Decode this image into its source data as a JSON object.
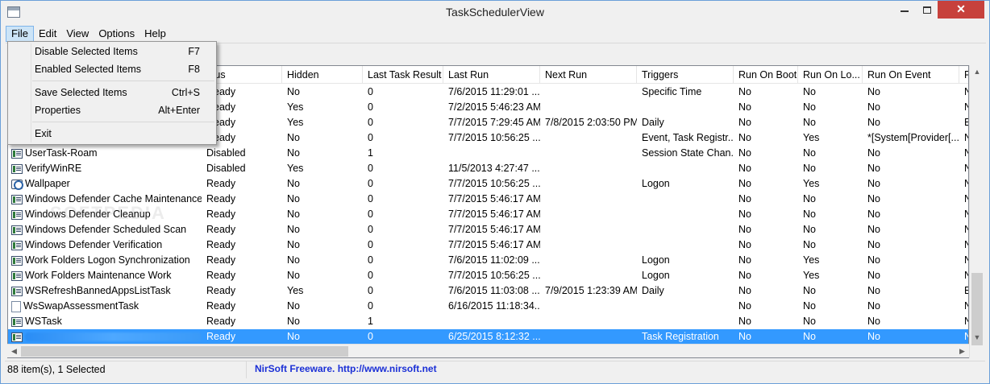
{
  "window": {
    "title": "TaskSchedulerView",
    "close_glyph": "✕"
  },
  "menubar": [
    "File",
    "Edit",
    "View",
    "Options",
    "Help"
  ],
  "file_menu": {
    "items": [
      {
        "label": "Disable Selected Items",
        "shortcut": "F7"
      },
      {
        "label": "Enabled Selected Items",
        "shortcut": "F8"
      },
      {
        "label": "Save Selected Items",
        "shortcut": "Ctrl+S"
      },
      {
        "label": "Properties",
        "shortcut": "Alt+Enter"
      },
      {
        "label": "Exit",
        "shortcut": ""
      }
    ]
  },
  "columns": [
    "",
    "atus",
    "Hidden",
    "Last Task Result",
    "Last Run",
    "Next Run",
    "Triggers",
    "Run On Boot",
    "Run On Lo...",
    "Run On Event",
    "R"
  ],
  "rows": [
    {
      "icon": "task",
      "name": "",
      "status": "Ready",
      "hidden": "No",
      "result": "0",
      "last_run": "7/6/2015 11:29:01 ...",
      "next_run": "",
      "triggers": "Specific Time",
      "boot": "No",
      "logon": "No",
      "event": "No",
      "r": "N"
    },
    {
      "icon": "task",
      "name": "",
      "status": "Ready",
      "hidden": "Yes",
      "result": "0",
      "last_run": "7/2/2015 5:46:23 AM",
      "next_run": "",
      "triggers": "",
      "boot": "No",
      "logon": "No",
      "event": "No",
      "r": "N"
    },
    {
      "icon": "task",
      "name": "",
      "status": "Ready",
      "hidden": "Yes",
      "result": "0",
      "last_run": "7/7/2015 7:29:45 AM",
      "next_run": "7/8/2015 2:03:50 PM",
      "triggers": "Daily",
      "boot": "No",
      "logon": "No",
      "event": "No",
      "r": "E"
    },
    {
      "icon": "task",
      "name": "",
      "status": "Ready",
      "hidden": "No",
      "result": "0",
      "last_run": "7/7/2015 10:56:25 ...",
      "next_run": "",
      "triggers": "Event, Task Registr...",
      "boot": "No",
      "logon": "Yes",
      "event": "*[System[Provider[...",
      "r": "N"
    },
    {
      "icon": "task",
      "name": "UserTask-Roam",
      "status": "Disabled",
      "hidden": "No",
      "result": "1",
      "last_run": "",
      "next_run": "",
      "triggers": "Session State Chan...",
      "boot": "No",
      "logon": "No",
      "event": "No",
      "r": "N"
    },
    {
      "icon": "task",
      "name": "VerifyWinRE",
      "status": "Disabled",
      "hidden": "Yes",
      "result": "0",
      "last_run": "11/5/2013 4:27:47 ...",
      "next_run": "",
      "triggers": "",
      "boot": "No",
      "logon": "No",
      "event": "No",
      "r": "N"
    },
    {
      "icon": "gear",
      "name": "Wallpaper",
      "status": "Ready",
      "hidden": "No",
      "result": "0",
      "last_run": "7/7/2015 10:56:25 ...",
      "next_run": "",
      "triggers": "Logon",
      "boot": "No",
      "logon": "Yes",
      "event": "No",
      "r": "N"
    },
    {
      "icon": "task",
      "name": "Windows Defender Cache Maintenance",
      "status": "Ready",
      "hidden": "No",
      "result": "0",
      "last_run": "7/7/2015 5:46:17 AM",
      "next_run": "",
      "triggers": "",
      "boot": "No",
      "logon": "No",
      "event": "No",
      "r": "N"
    },
    {
      "icon": "task",
      "name": "Windows Defender Cleanup",
      "status": "Ready",
      "hidden": "No",
      "result": "0",
      "last_run": "7/7/2015 5:46:17 AM",
      "next_run": "",
      "triggers": "",
      "boot": "No",
      "logon": "No",
      "event": "No",
      "r": "N"
    },
    {
      "icon": "task",
      "name": "Windows Defender Scheduled Scan",
      "status": "Ready",
      "hidden": "No",
      "result": "0",
      "last_run": "7/7/2015 5:46:17 AM",
      "next_run": "",
      "triggers": "",
      "boot": "No",
      "logon": "No",
      "event": "No",
      "r": "N"
    },
    {
      "icon": "task",
      "name": "Windows Defender Verification",
      "status": "Ready",
      "hidden": "No",
      "result": "0",
      "last_run": "7/7/2015 5:46:17 AM",
      "next_run": "",
      "triggers": "",
      "boot": "No",
      "logon": "No",
      "event": "No",
      "r": "N"
    },
    {
      "icon": "task",
      "name": "Work Folders Logon Synchronization",
      "status": "Ready",
      "hidden": "No",
      "result": "0",
      "last_run": "7/6/2015 11:02:09 ...",
      "next_run": "",
      "triggers": "Logon",
      "boot": "No",
      "logon": "Yes",
      "event": "No",
      "r": "N"
    },
    {
      "icon": "task",
      "name": "Work Folders Maintenance Work",
      "status": "Ready",
      "hidden": "No",
      "result": "0",
      "last_run": "7/7/2015 10:56:25 ...",
      "next_run": "",
      "triggers": "Logon",
      "boot": "No",
      "logon": "Yes",
      "event": "No",
      "r": "N"
    },
    {
      "icon": "task",
      "name": "WSRefreshBannedAppsListTask",
      "status": "Ready",
      "hidden": "Yes",
      "result": "0",
      "last_run": "7/6/2015 11:03:08 ...",
      "next_run": "7/9/2015 1:23:39 AM",
      "triggers": "Daily",
      "boot": "No",
      "logon": "No",
      "event": "No",
      "r": "E"
    },
    {
      "icon": "page",
      "name": "WsSwapAssessmentTask",
      "status": "Ready",
      "hidden": "No",
      "result": "0",
      "last_run": "6/16/2015 11:18:34...",
      "next_run": "",
      "triggers": "",
      "boot": "No",
      "logon": "No",
      "event": "No",
      "r": "N"
    },
    {
      "icon": "task",
      "name": "WSTask",
      "status": "Ready",
      "hidden": "No",
      "result": "1",
      "last_run": "",
      "next_run": "",
      "triggers": "",
      "boot": "No",
      "logon": "No",
      "event": "No",
      "r": "N"
    },
    {
      "icon": "task",
      "name": "",
      "status": "Ready",
      "hidden": "No",
      "result": "0",
      "last_run": "6/25/2015 8:12:32 ...",
      "next_run": "",
      "triggers": "Task Registration",
      "boot": "No",
      "logon": "No",
      "event": "No",
      "r": "N",
      "selected": true
    }
  ],
  "statusbar": {
    "count": "88 item(s), 1 Selected",
    "link": "NirSoft Freeware.  http://www.nirsoft.net"
  },
  "watermark": "SOFTPEDIA",
  "colors": {
    "selection": "#3399ff",
    "link": "#1a2fd6",
    "close_button": "#c7413c"
  }
}
